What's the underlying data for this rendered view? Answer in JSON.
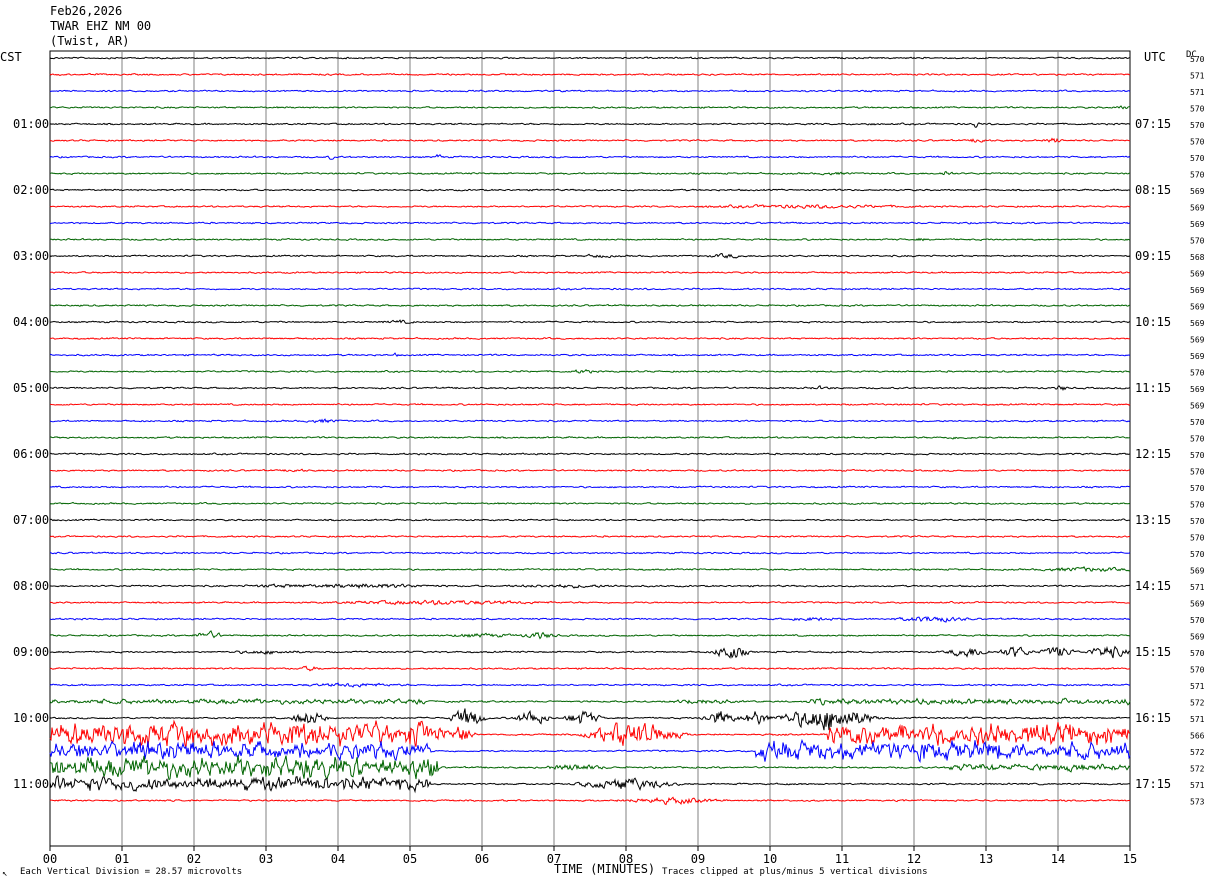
{
  "header": {
    "date": "Feb26,2026",
    "station": "TWAR EHZ NM 00",
    "location": "(Twist, AR)"
  },
  "left_axis_label": "CST",
  "right_axis_label": "UTC",
  "dc_label": "DC",
  "footer": {
    "scale_note": "Each Vertical Division =   28.57 microvolts",
    "clip_note": "Traces clipped at plus/minus 5 vertical divisions",
    "corner_mark": "↖"
  },
  "colors": {
    "trace_cycle": [
      "#000000",
      "#ff0000",
      "#0000ff",
      "#006400"
    ],
    "grid": "#808080"
  },
  "chart_data": {
    "type": "line",
    "title": "",
    "xlabel": "TIME (MINUTES)",
    "ylabel": "",
    "xlim": [
      0,
      15
    ],
    "x_ticks": [
      "00",
      "01",
      "02",
      "03",
      "04",
      "05",
      "06",
      "07",
      "08",
      "09",
      "10",
      "11",
      "12",
      "13",
      "14",
      "15"
    ],
    "left_time_labels": [
      "01:00",
      "02:00",
      "03:00",
      "04:00",
      "05:00",
      "06:00",
      "07:00",
      "08:00",
      "09:00",
      "10:00",
      "11:00"
    ],
    "right_time_labels": [
      "07:15",
      "08:15",
      "09:15",
      "10:15",
      "11:15",
      "12:15",
      "13:15",
      "14:15",
      "15:15",
      "16:15",
      "17:15"
    ],
    "hour_label_rows": [
      4,
      8,
      12,
      16,
      20,
      24,
      28,
      32,
      36,
      40,
      44
    ],
    "dc_offsets": [
      570,
      571,
      571,
      570,
      570,
      570,
      570,
      570,
      569,
      569,
      569,
      570,
      568,
      569,
      569,
      569,
      569,
      569,
      569,
      570,
      569,
      569,
      570,
      570,
      570,
      570,
      570,
      570,
      570,
      570,
      570,
      569,
      571,
      569,
      570,
      569,
      570,
      570,
      571,
      572,
      571,
      566,
      572,
      572,
      571,
      573
    ],
    "trace_count": 46,
    "events": [
      {
        "row": 3,
        "t": 14.9,
        "amp": 0.4,
        "dur": 0.15
      },
      {
        "row": 4,
        "t": 12.85,
        "amp": 1.2,
        "dur": 0.08
      },
      {
        "row": 4,
        "t": 11.4,
        "amp": 0.3,
        "dur": 0.1
      },
      {
        "row": 5,
        "t": 12.9,
        "amp": 0.8,
        "dur": 0.15
      },
      {
        "row": 5,
        "t": 13.95,
        "amp": 0.8,
        "dur": 0.15
      },
      {
        "row": 6,
        "t": 3.9,
        "amp": 0.8,
        "dur": 0.05
      },
      {
        "row": 6,
        "t": 5.4,
        "amp": 1.1,
        "dur": 0.05
      },
      {
        "row": 7,
        "t": 12.45,
        "amp": 1.1,
        "dur": 0.1
      },
      {
        "row": 7,
        "t": 10.9,
        "amp": 0.3,
        "dur": 0.3
      },
      {
        "row": 9,
        "t": 10.5,
        "amp": 0.45,
        "dur": 1.8
      },
      {
        "row": 11,
        "t": 12.1,
        "amp": 0.3,
        "dur": 0.1
      },
      {
        "row": 12,
        "t": 7.6,
        "amp": 0.4,
        "dur": 0.3
      },
      {
        "row": 12,
        "t": 9.4,
        "amp": 0.6,
        "dur": 0.3
      },
      {
        "row": 16,
        "t": 4.85,
        "amp": 0.4,
        "dur": 0.3
      },
      {
        "row": 18,
        "t": 4.8,
        "amp": 0.5,
        "dur": 0.05
      },
      {
        "row": 19,
        "t": 7.4,
        "amp": 0.6,
        "dur": 0.2
      },
      {
        "row": 20,
        "t": 10.7,
        "amp": 0.4,
        "dur": 0.2
      },
      {
        "row": 20,
        "t": 14.05,
        "amp": 0.9,
        "dur": 0.1
      },
      {
        "row": 22,
        "t": 3.8,
        "amp": 0.5,
        "dur": 0.3
      },
      {
        "row": 23,
        "t": 12.6,
        "amp": 0.3,
        "dur": 0.3
      },
      {
        "row": 25,
        "t": 3.4,
        "amp": 0.4,
        "dur": 0.2
      },
      {
        "row": 31,
        "t": 14.4,
        "amp": 0.6,
        "dur": 0.8
      },
      {
        "row": 32,
        "t": 4.4,
        "amp": 0.6,
        "dur": 1.2
      },
      {
        "row": 32,
        "t": 3.2,
        "amp": 0.4,
        "dur": 0.6
      },
      {
        "row": 32,
        "t": 7.2,
        "amp": 0.4,
        "dur": 1.0
      },
      {
        "row": 33,
        "t": 5.4,
        "amp": 0.6,
        "dur": 1.8
      },
      {
        "row": 34,
        "t": 12.25,
        "amp": 0.9,
        "dur": 0.6
      },
      {
        "row": 34,
        "t": 10.6,
        "amp": 0.4,
        "dur": 0.5
      },
      {
        "row": 35,
        "t": 2.2,
        "amp": 1.2,
        "dur": 0.25
      },
      {
        "row": 35,
        "t": 6.8,
        "amp": 1.0,
        "dur": 0.3
      },
      {
        "row": 35,
        "t": 6.0,
        "amp": 0.5,
        "dur": 0.6
      },
      {
        "row": 36,
        "t": 9.45,
        "amp": 2.5,
        "dur": 0.3
      },
      {
        "row": 36,
        "t": 12.75,
        "amp": 1.8,
        "dur": 0.35
      },
      {
        "row": 36,
        "t": 13.4,
        "amp": 1.8,
        "dur": 0.3
      },
      {
        "row": 36,
        "t": 14.0,
        "amp": 1.8,
        "dur": 0.3
      },
      {
        "row": 36,
        "t": 14.7,
        "amp": 2.2,
        "dur": 0.35
      },
      {
        "row": 36,
        "t": 3.0,
        "amp": 0.5,
        "dur": 0.6
      },
      {
        "row": 37,
        "t": 3.6,
        "amp": 0.6,
        "dur": 0.2
      },
      {
        "row": 38,
        "t": 4.2,
        "amp": 0.5,
        "dur": 0.8
      },
      {
        "row": 39,
        "t": 9.1,
        "amp": 0.8,
        "dur": 0.6
      },
      {
        "row": 40,
        "t": 5.8,
        "amp": 3.5,
        "dur": 0.3
      },
      {
        "row": 40,
        "t": 6.7,
        "amp": 2.5,
        "dur": 0.3
      },
      {
        "row": 40,
        "t": 7.4,
        "amp": 2.5,
        "dur": 0.3
      },
      {
        "row": 40,
        "t": 9.3,
        "amp": 2.5,
        "dur": 0.3
      },
      {
        "row": 40,
        "t": 9.8,
        "amp": 2.5,
        "dur": 0.25
      },
      {
        "row": 40,
        "t": 3.6,
        "amp": 2.5,
        "dur": 0.3
      },
      {
        "row": 40,
        "t": 10.8,
        "amp": 4.5,
        "dur": 0.8
      },
      {
        "row": 41,
        "t": 5.7,
        "amp": 3.0,
        "dur": 0.25
      },
      {
        "row": 41,
        "t": 8.1,
        "amp": 4.5,
        "dur": 0.8
      },
      {
        "row": 43,
        "t": 7.3,
        "amp": 1.0,
        "dur": 0.5
      },
      {
        "row": 44,
        "t": 8.0,
        "amp": 2.0,
        "dur": 0.8
      },
      {
        "row": 45,
        "t": 8.6,
        "amp": 1.0,
        "dur": 0.8
      },
      {
        "row": 46,
        "t": 7.3,
        "amp": 0.8,
        "dur": 0.6
      }
    ],
    "bursts": [
      {
        "row": 41,
        "t0": 0.0,
        "t1": 5.5,
        "amp": 4.5
      },
      {
        "row": 42,
        "t0": 0.0,
        "t1": 5.3,
        "amp": 3.0
      },
      {
        "row": 43,
        "t0": 0.0,
        "t1": 5.4,
        "amp": 4.0
      },
      {
        "row": 44,
        "t0": 0.0,
        "t1": 5.3,
        "amp": 2.5
      },
      {
        "row": 42,
        "t0": 9.8,
        "t1": 15.0,
        "amp": 3.5
      },
      {
        "row": 41,
        "t0": 10.8,
        "t1": 15.0,
        "amp": 4.0
      },
      {
        "row": 43,
        "t0": 12.5,
        "t1": 15.0,
        "amp": 1.0
      },
      {
        "row": 39,
        "t0": 0.0,
        "t1": 5.2,
        "amp": 0.7
      },
      {
        "row": 39,
        "t0": 10.5,
        "t1": 15.0,
        "amp": 0.8
      }
    ]
  }
}
